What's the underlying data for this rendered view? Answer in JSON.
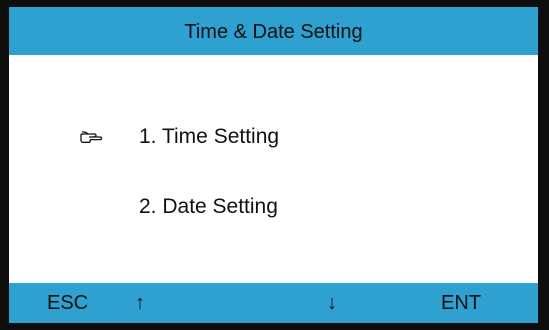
{
  "screen": {
    "title": "Time & Date Setting",
    "menu": [
      {
        "label": "1.  Time Setting",
        "selected": true
      },
      {
        "label": "2.  Date Setting",
        "selected": false
      }
    ],
    "pointer_icon": "pointing-hand-icon",
    "footer": {
      "esc": "ESC",
      "up": "↑",
      "down": "↓",
      "enter": "ENT"
    }
  },
  "colors": {
    "bar": "#2fa1d0",
    "frame": "#0d0d0d",
    "panel": "#ffffff",
    "text": "#111111"
  }
}
